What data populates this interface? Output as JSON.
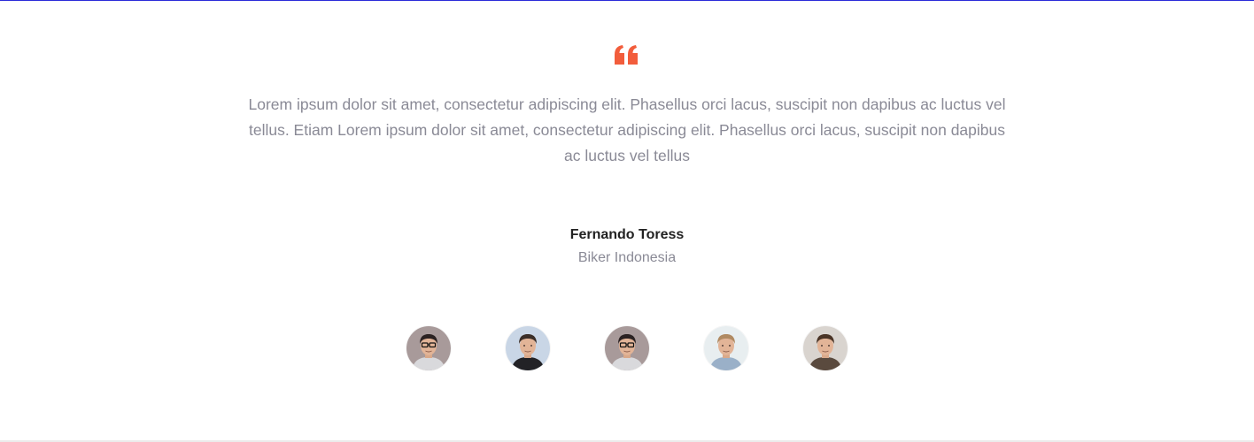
{
  "quote_icon": {
    "name": "quote-icon",
    "color": "#f25d3c"
  },
  "testimonial": {
    "text": "Lorem ipsum dolor sit amet, consectetur adipiscing elit. Phasellus orci lacus, suscipit non dapibus ac luctus vel tellus. Etiam Lorem ipsum dolor sit amet, consectetur adipiscing elit. Phasellus orci lacus, suscipit non dapibus ac luctus vel tellus",
    "author_name": "Fernando Toress",
    "author_role": "Biker Indonesia"
  },
  "avatars": [
    {
      "name": "avatar-1",
      "icon": "person-glasses-photo",
      "bg": "#a89a9a",
      "shirt": "#d9d9dc",
      "hair": "#2b2222"
    },
    {
      "name": "avatar-2",
      "icon": "person-photo",
      "bg": "#c9d6e6",
      "shirt": "#222226",
      "hair": "#3a2e28"
    },
    {
      "name": "avatar-3",
      "icon": "person-glasses-photo",
      "bg": "#a89a9a",
      "shirt": "#d9d9dc",
      "hair": "#2b2222"
    },
    {
      "name": "avatar-4",
      "icon": "person-photo",
      "bg": "#e8eef0",
      "shirt": "#9ab0c8",
      "hair": "#b08a62"
    },
    {
      "name": "avatar-5",
      "icon": "person-photo",
      "bg": "#d9d4cf",
      "shirt": "#5a4a3e",
      "hair": "#4a3426"
    }
  ],
  "colors": {
    "accent": "#f25d3c",
    "body_text": "#8a8a96",
    "heading_text": "#222222",
    "top_border": "#2b2bd9"
  }
}
